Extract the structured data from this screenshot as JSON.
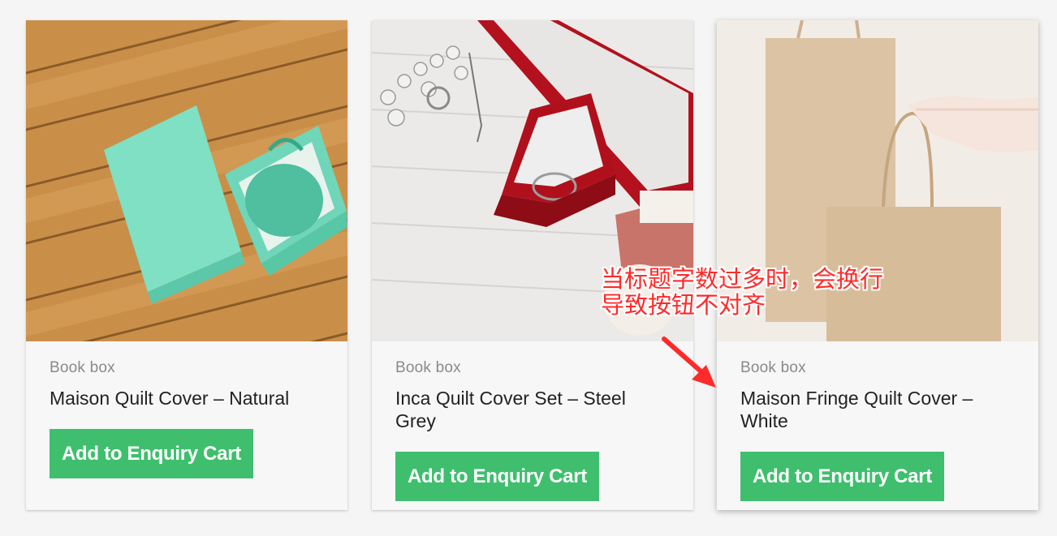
{
  "products": [
    {
      "category": "Book box",
      "title": "Maison Quilt Cover – Natural",
      "button": "Add to Enquiry Cart",
      "image": "mint-gift-box-on-wood"
    },
    {
      "category": "Book box",
      "title": "Inca Quilt Cover Set – Steel Grey",
      "button": "Add to Enquiry Cart",
      "image": "red-ring-box-with-jewelry"
    },
    {
      "category": "Book box",
      "title": "Maison Fringe Quilt Cover – White",
      "button": "Add to Enquiry Cart",
      "image": "kraft-paper-bags"
    }
  ],
  "annotation": {
    "line1": "当标题字数过多时，会换行",
    "line2": "导致按钮不对齐",
    "color": "#ff2a2a"
  },
  "colors": {
    "button": "#3fbf6e",
    "card": "#f7f7f7",
    "background": "#f5f5f5"
  }
}
